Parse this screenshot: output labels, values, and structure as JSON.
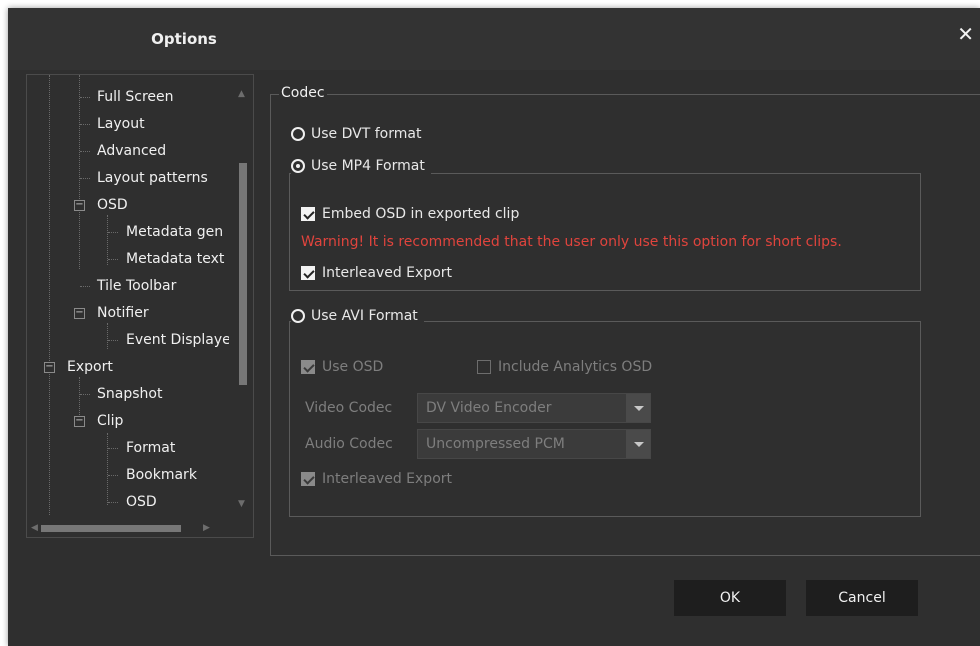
{
  "dialog": {
    "title": "Options",
    "close_glyph": "✕"
  },
  "tree": {
    "items": [
      {
        "label": "Full Screen"
      },
      {
        "label": "Layout"
      },
      {
        "label": "Advanced"
      },
      {
        "label": "Layout patterns"
      },
      {
        "label": "OSD"
      },
      {
        "label": "Metadata gen"
      },
      {
        "label": "Metadata text"
      },
      {
        "label": "Tile Toolbar"
      },
      {
        "label": "Notifier"
      },
      {
        "label": "Event Displaye"
      },
      {
        "label": "Export"
      },
      {
        "label": "Snapshot"
      },
      {
        "label": "Clip"
      },
      {
        "label": "Format"
      },
      {
        "label": "Bookmark"
      },
      {
        "label": "OSD"
      }
    ],
    "expander_glyph": "−"
  },
  "codec": {
    "legend": "Codec",
    "dvt_label": "Use DVT format",
    "mp4_label": "Use MP4 Format",
    "mp4": {
      "embed_osd_label": "Embed OSD in exported clip",
      "warning": "Warning! It is recommended that the user only use this option for short clips.",
      "interleaved_label": "Interleaved Export"
    },
    "avi_label": "Use AVI Format",
    "avi": {
      "use_osd_label": "Use OSD",
      "include_analytics_label": "Include Analytics OSD",
      "video_codec_label": "Video Codec",
      "video_codec_value": "DV Video Encoder",
      "audio_codec_label": "Audio Codec",
      "audio_codec_value": "Uncompressed PCM",
      "interleaved_label": "Interleaved Export"
    },
    "selected": "mp4"
  },
  "buttons": {
    "ok": "OK",
    "cancel": "Cancel"
  },
  "colors": {
    "background": "#2f2f2f",
    "warning": "#e0443d",
    "button": "#1e1e1e"
  }
}
